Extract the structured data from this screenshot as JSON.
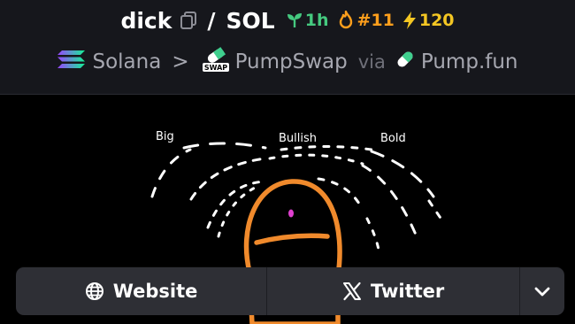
{
  "header": {
    "token_symbol": "dick",
    "separator": "/",
    "quote_symbol": "SOL",
    "age": "1h",
    "rank": "#11",
    "boosts": "120"
  },
  "chain_row": {
    "chain": "Solana",
    "chevron": ">",
    "dex": "PumpSwap",
    "dex_logo_text": "SWAP",
    "via_label": "via",
    "launchpad": "Pump.fun"
  },
  "banner": {
    "words": [
      "Big",
      "Bullish",
      "Bold"
    ],
    "colors": {
      "outline": "#f08a2c",
      "eye": "#e040d0",
      "rays": "#ffffff"
    }
  },
  "links": {
    "website_label": "Website",
    "twitter_label": "Twitter"
  },
  "icons": {
    "copy": "copy-icon",
    "seedling": "seedling-icon",
    "flame": "flame-icon",
    "bolt": "bolt-icon",
    "solana": "solana-logo-icon",
    "pumpswap": "pumpswap-logo-icon",
    "pill": "pumpfun-pill-icon",
    "globe": "globe-icon",
    "x": "x-logo-icon",
    "chevron": "chevron-down-icon"
  },
  "colors": {
    "background": "#16171c",
    "accent_green": "#45c97f",
    "accent_orange": "#ff9f1c",
    "accent_yellow": "#f3c623",
    "button_bg": "#2e2f35"
  }
}
